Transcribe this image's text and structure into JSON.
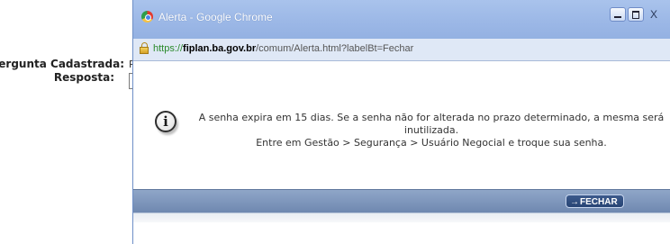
{
  "background_page": {
    "pergunta_label": "*Pergunta Cadastrada:",
    "pergunta_value": "Pri",
    "resposta_label": "Resposta:"
  },
  "window": {
    "title": "Alerta - Google Chrome",
    "close_label": "X",
    "url": {
      "scheme": "https://",
      "host": "fiplan.ba.gov.br",
      "path": "/comum/Alerta.html?labelBt=Fechar"
    }
  },
  "alert": {
    "line1": "A senha expira em 15 dias. Se a senha não for alterada no prazo determinado, a mesma será inutilizada.",
    "line2": "Entre em Gestão > Segurança > Usuário Negocial e troque sua senha.",
    "icon_glyph": "i",
    "button_label": "FECHAR",
    "button_arrow": "→"
  }
}
